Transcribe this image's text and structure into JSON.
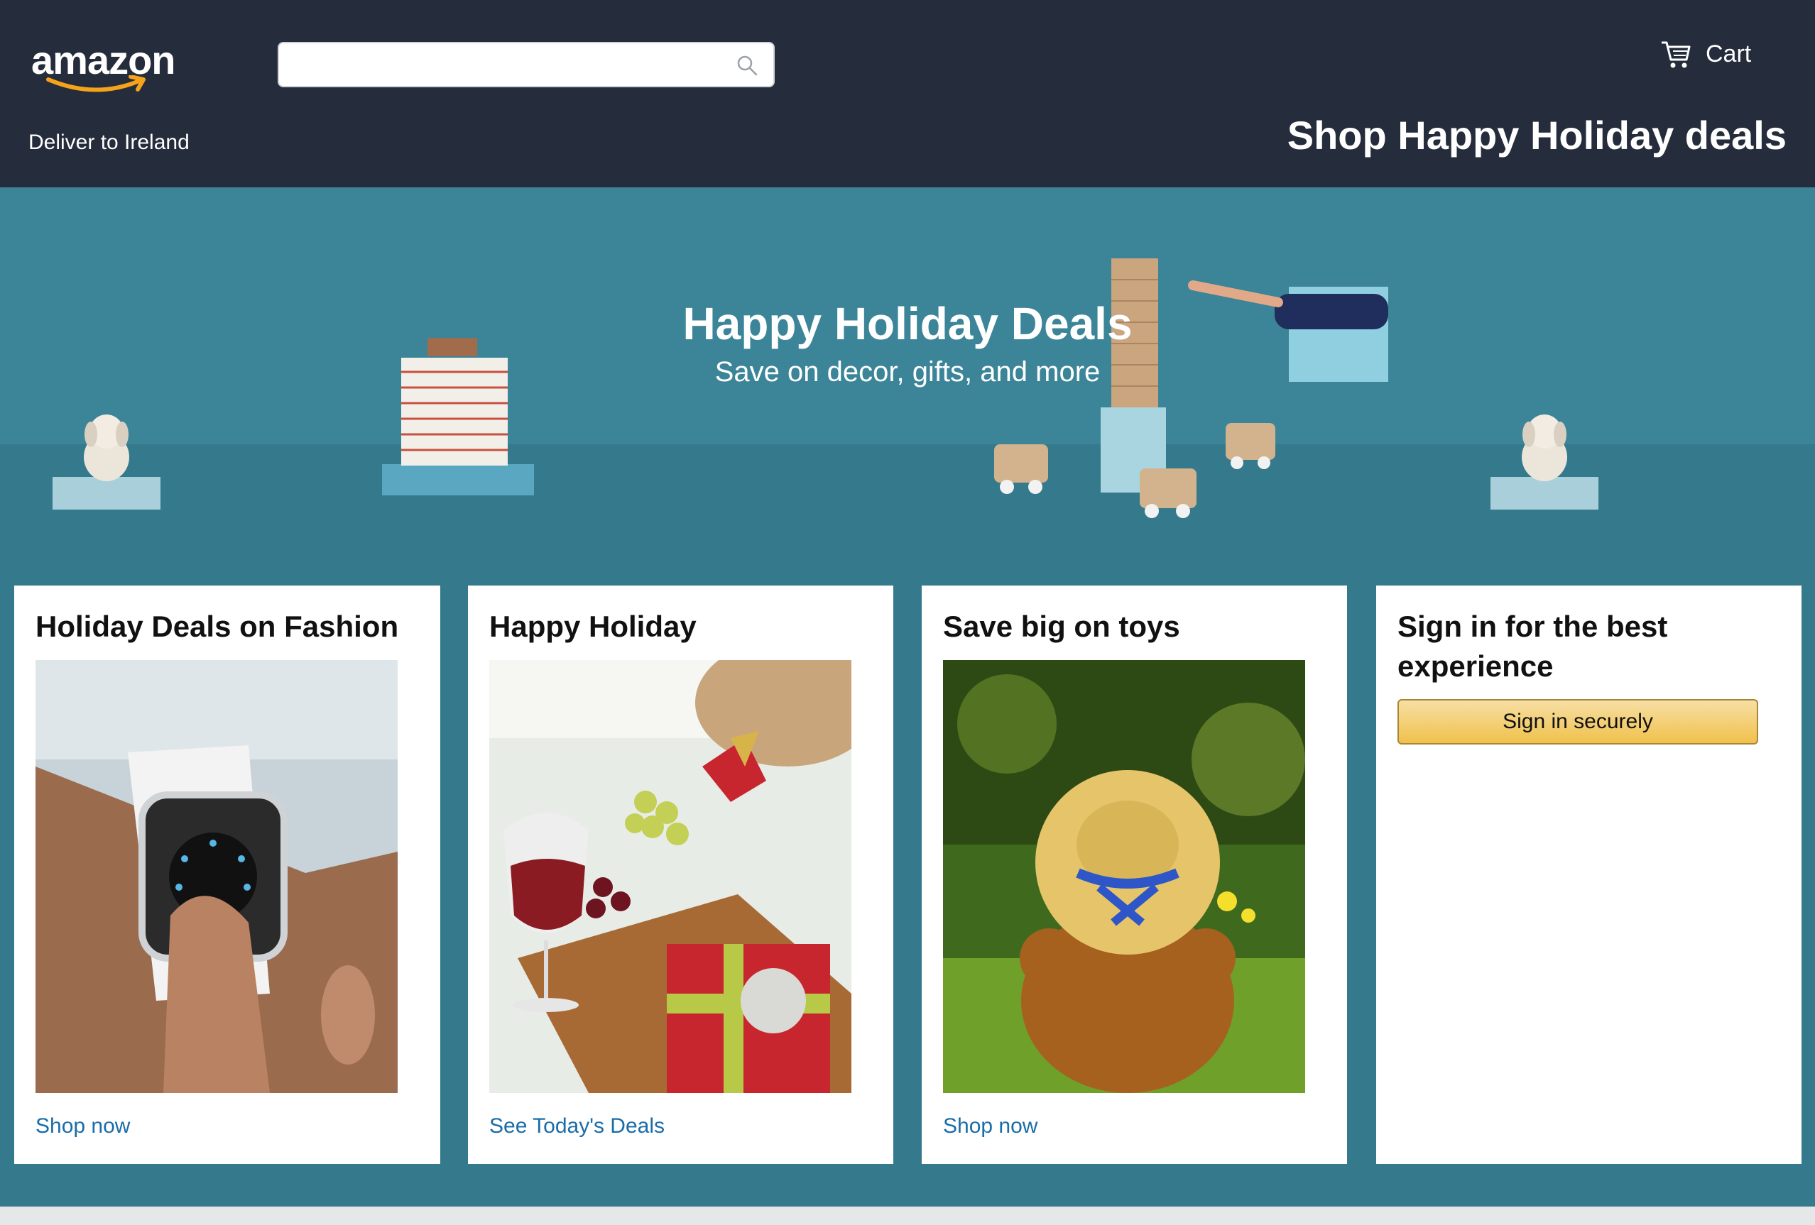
{
  "header": {
    "logo_text": "amazon",
    "search": {
      "placeholder": "",
      "value": ""
    },
    "cart_label": "Cart",
    "deliver_text": "Deliver to Ireland",
    "promo_title": "Shop Happy Holiday deals"
  },
  "hero": {
    "title": "Happy Holiday Deals",
    "subtitle": "Save on decor, gifts, and more"
  },
  "cards": [
    {
      "title": "Holiday Deals on Fashion",
      "image": "smartwatch-photo",
      "link": "Shop now"
    },
    {
      "title": "Happy Holiday",
      "image": "gifts-and-wine-photo",
      "link": "See Today's Deals"
    },
    {
      "title": "Save big on toys",
      "image": "teddy-bear-photo",
      "link": "Shop now"
    },
    {
      "title": "Sign in for the best experience",
      "button": "Sign in securely"
    }
  ],
  "colors": {
    "header_bg": "#252d3c",
    "hero_bg": "#3c8598",
    "link": "#1a6ca8",
    "signin_button": "#f0c14b",
    "logo_smile": "#f6a21b"
  }
}
